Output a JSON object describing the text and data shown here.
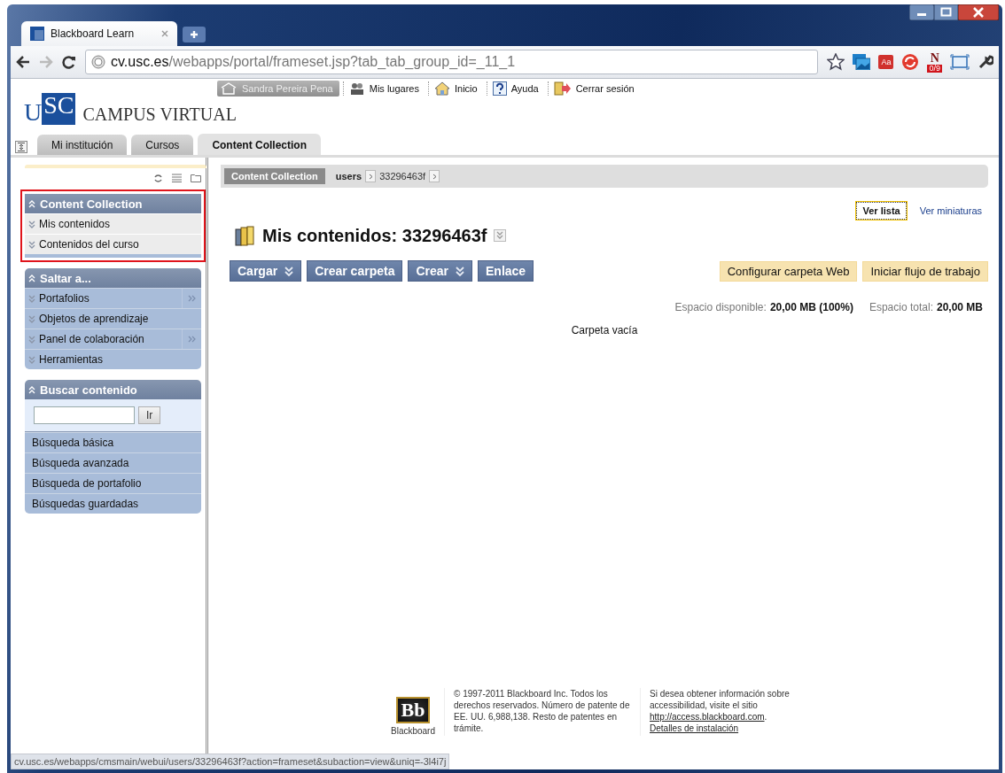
{
  "browser": {
    "tab_title": "Blackboard Learn",
    "url_host": "cv.usc.es",
    "url_path": "/webapps/portal/frameset.jsp?tab_tab_group_id=_11_1",
    "ext_acrobat": "Aa",
    "ext_letter": "N",
    "ext_badge": "0/9"
  },
  "header": {
    "logo_outer": "U",
    "logo_inner": "SC",
    "site_name": "CAMPUS VIRTUAL",
    "user": "Sandra Pereira Pena",
    "nav": [
      {
        "label": "Mis lugares",
        "kind": "places"
      },
      {
        "label": "Inicio",
        "kind": "home"
      },
      {
        "label": "Ayuda",
        "kind": "help"
      },
      {
        "label": "Cerrar sesión",
        "kind": "logout"
      }
    ]
  },
  "tabs": [
    {
      "label": "Mi institución",
      "selected": false
    },
    {
      "label": "Cursos",
      "selected": false
    },
    {
      "label": "Content Collection",
      "selected": true
    }
  ],
  "sidebar": {
    "modules": [
      {
        "title": "Content Collection",
        "outlined": true,
        "items": [
          {
            "label": "Mis contenidos",
            "flyout": false
          },
          {
            "label": "Contenidos del curso",
            "flyout": false
          }
        ]
      },
      {
        "title": "Saltar a...",
        "outlined": false,
        "items": [
          {
            "label": "Portafolios",
            "flyout": true
          },
          {
            "label": "Objetos de aprendizaje",
            "flyout": false
          },
          {
            "label": "Panel de colaboración",
            "flyout": true
          },
          {
            "label": "Herramientas",
            "flyout": false
          }
        ]
      }
    ],
    "search": {
      "title": "Buscar contenido",
      "button": "Ir",
      "links": [
        "Búsqueda básica",
        "Búsqueda avanzada",
        "Búsqueda de portafolio",
        "Búsquedas guardadas"
      ]
    }
  },
  "breadcrumb": [
    {
      "label": "Content Collection",
      "kind": "root"
    },
    {
      "label": "users",
      "kind": "folder"
    },
    {
      "label": "33296463f",
      "kind": "current"
    }
  ],
  "views": [
    {
      "label": "Ver lista",
      "selected": true
    },
    {
      "label": "Ver miniaturas",
      "selected": false
    }
  ],
  "page_title": "Mis contenidos: 33296463f",
  "actions": [
    {
      "label": "Cargar",
      "dropdown": true
    },
    {
      "label": "Crear carpeta",
      "dropdown": false
    },
    {
      "label": "Crear",
      "dropdown": true
    },
    {
      "label": "Enlace",
      "dropdown": false
    }
  ],
  "secondary_actions": [
    "Configurar carpeta Web",
    "Iniciar flujo de trabajo"
  ],
  "storage": [
    {
      "label": "Espacio disponible:",
      "value": "20,00 MB (100%)"
    },
    {
      "label": "Espacio total:",
      "value": "20,00 MB"
    }
  ],
  "empty_message": "Carpeta vacía",
  "footer": {
    "logo": "Bb",
    "logo_caption": "Blackboard",
    "copyright": "© 1997-2011 Blackboard Inc. Todos los derechos reservados. Número de patente de EE. UU. 6,988,138. Resto de patentes en trámite.",
    "access_text": "Si desea obtener información sobre accessibilidad, visite el sitio",
    "access_link": "http://access.blackboard.com",
    "access_end": ".",
    "install_link": "Detalles de instalación"
  },
  "status_bar": "cv.usc.es/webapps/cmsmain/webui/users/33296463f?action=frameset&subaction=view&uniq=-3l4i7j"
}
